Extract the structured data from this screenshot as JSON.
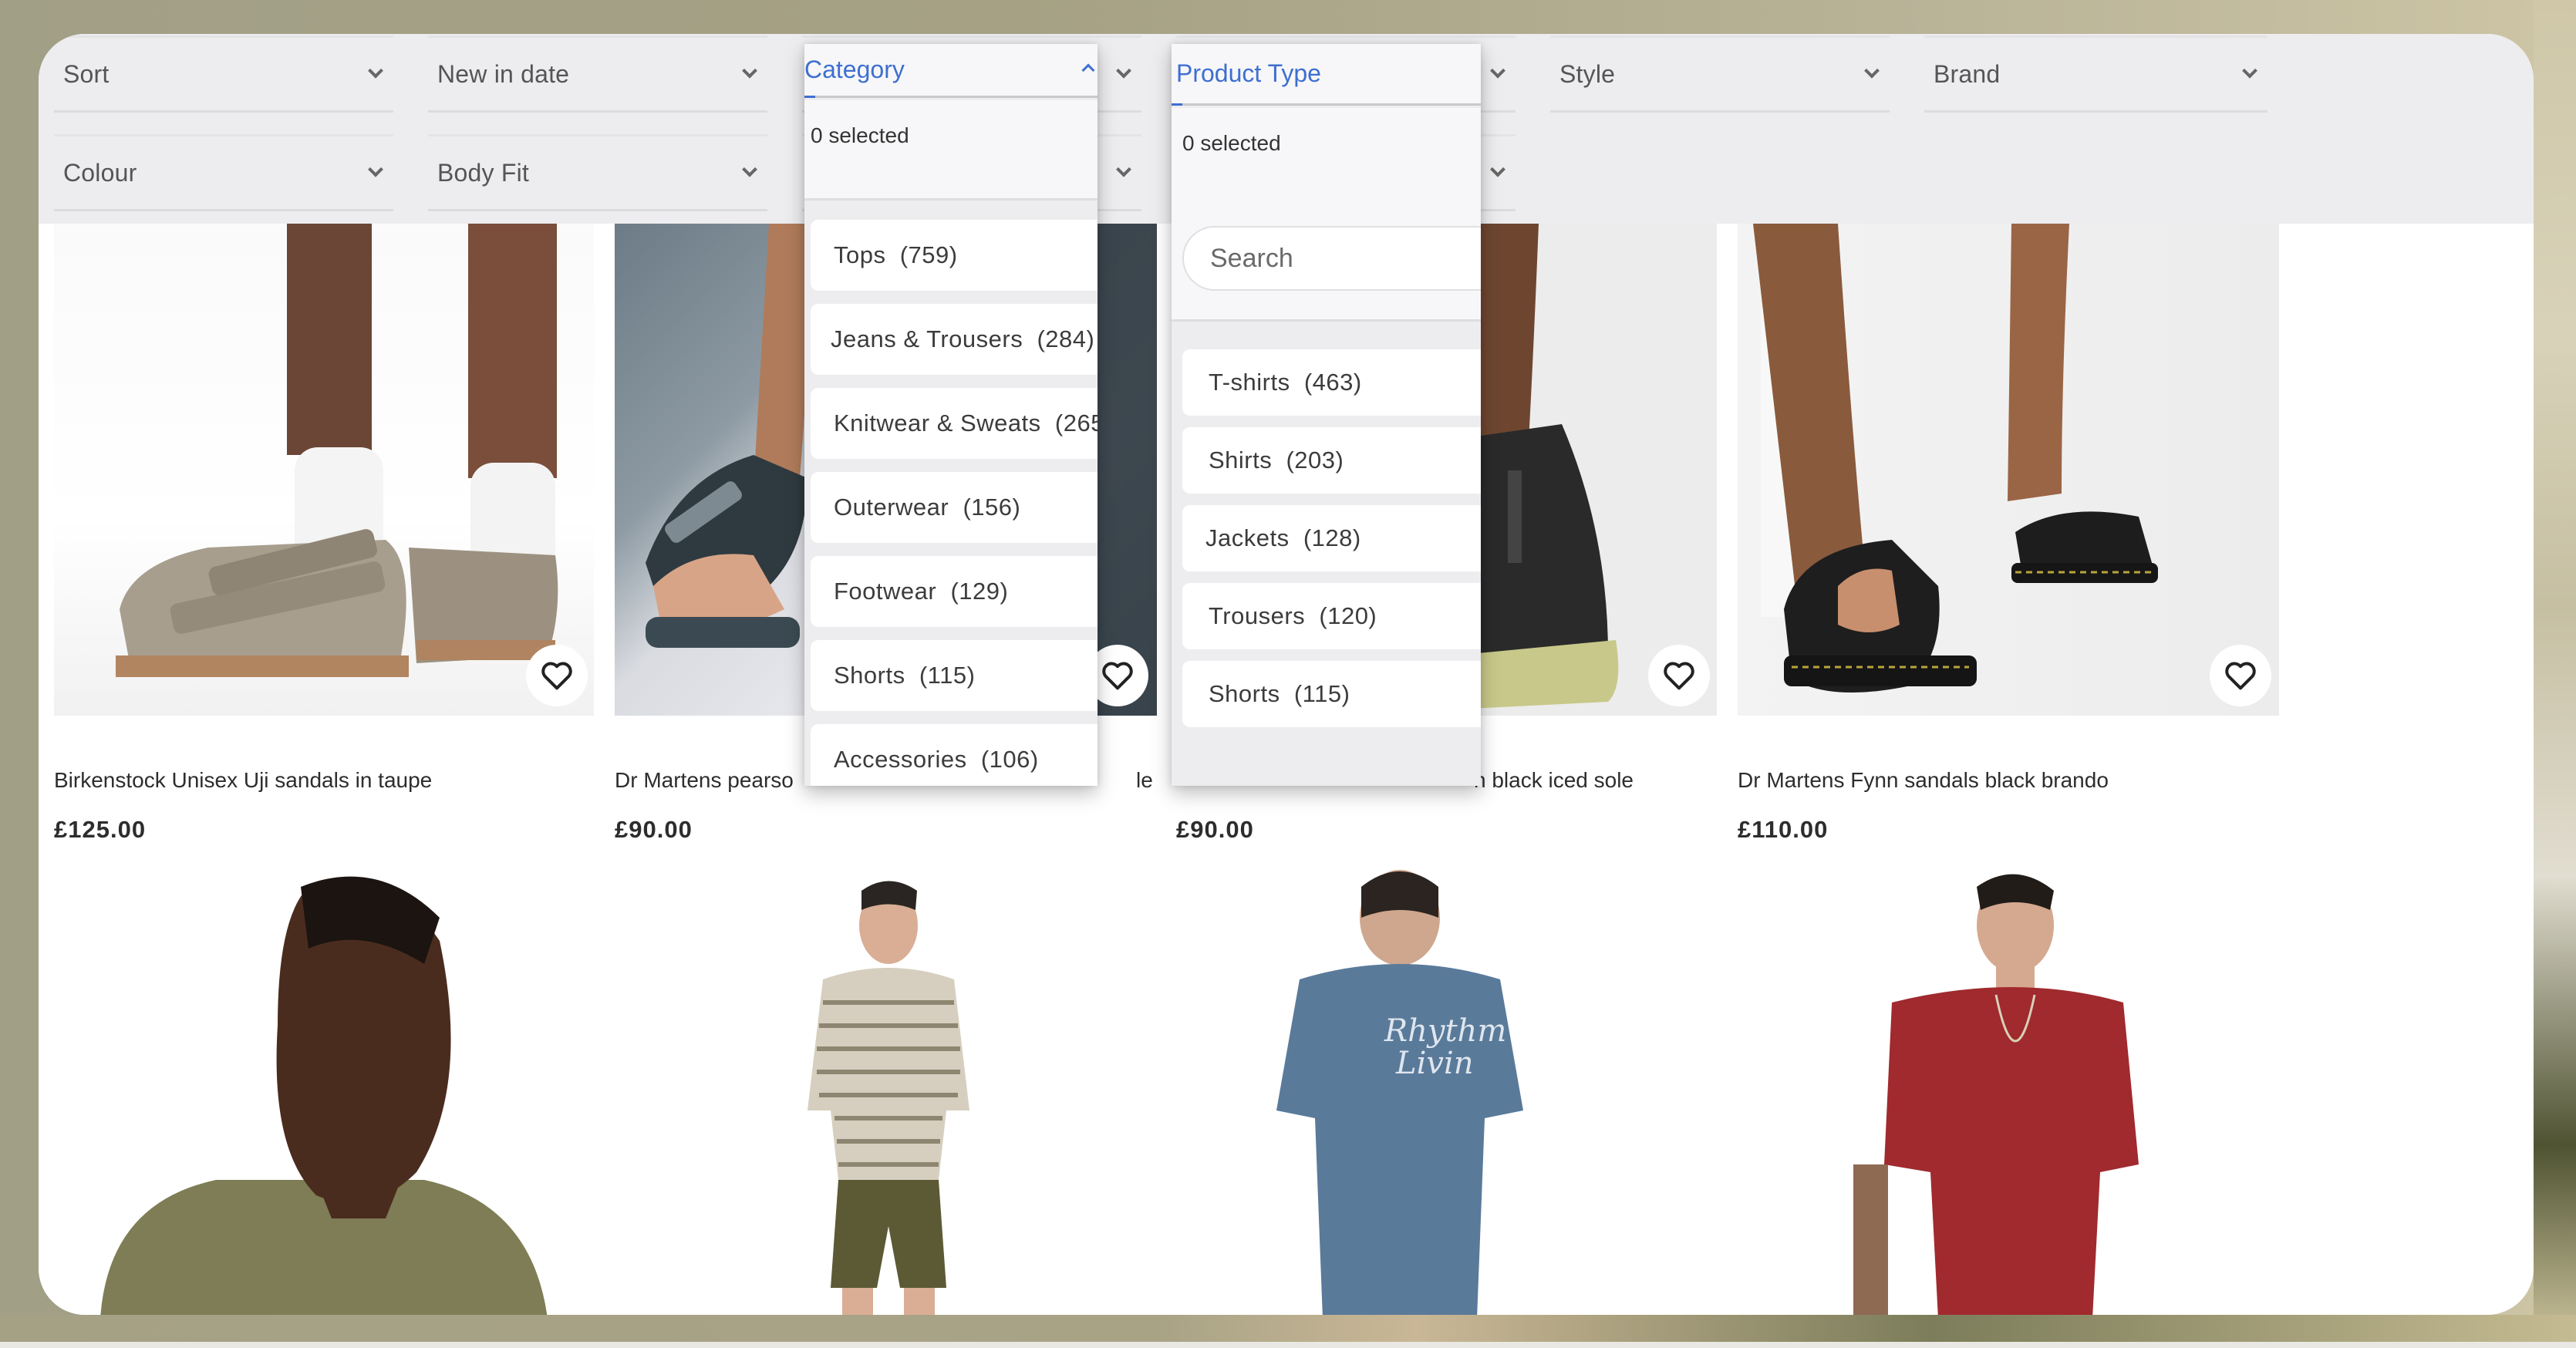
{
  "filters": {
    "row1": [
      {
        "label": "Sort"
      },
      {
        "label": "New in date"
      },
      {
        "label": "Category"
      },
      {
        "label": "Product Type"
      },
      {
        "label": "Style"
      },
      {
        "label": "Brand"
      }
    ],
    "row2": [
      {
        "label": "Colour"
      },
      {
        "label": "Body Fit"
      }
    ]
  },
  "category_dropdown": {
    "title": "Category",
    "selected_count": "0 selected",
    "options": [
      {
        "label": "Tops",
        "count": "(759)"
      },
      {
        "label": "Jeans & Trousers",
        "count": "(284)"
      },
      {
        "label": "Knitwear & Sweats",
        "count": "(265"
      },
      {
        "label": "Outerwear",
        "count": "(156)"
      },
      {
        "label": "Footwear",
        "count": "(129)"
      },
      {
        "label": "Shorts",
        "count": "(115)"
      },
      {
        "label": "Accessories",
        "count": "(106)"
      }
    ]
  },
  "product_type_dropdown": {
    "title": "Product Type",
    "selected_count": "0 selected",
    "search_placeholder": "Search",
    "options": [
      {
        "label": "T-shirts",
        "count": "(463)"
      },
      {
        "label": "Shirts",
        "count": "(203)"
      },
      {
        "label": "Jackets",
        "count": "(128)"
      },
      {
        "label": "Trousers",
        "count": "(120)"
      },
      {
        "label": "Shorts",
        "count": "(115)"
      }
    ]
  },
  "products_row1": [
    {
      "name": "Birkenstock Unisex Uji sandals in taupe",
      "price": "£125.00",
      "image": "taupe-suede-sandals-with-white-socks"
    },
    {
      "name": "Dr Martens pearso",
      "name_tail": "le",
      "price": "£90.00",
      "image": "black-strappy-sandals-on-grey"
    },
    {
      "name_tail": "n black iced sole",
      "price": "£90.00",
      "image": "black-sandal-iced-sole"
    },
    {
      "name": "Dr Martens Fynn sandals black brando",
      "price": "£110.00",
      "image": "black-strappy-platform-sandals"
    }
  ],
  "products_row2": [
    {
      "image": "model-olive-tshirt-closeup"
    },
    {
      "image": "model-striped-tshirt-khaki-shorts"
    },
    {
      "image": "model-blue-rhythm-livin-tshirt-back"
    },
    {
      "image": "model-red-tshirt"
    }
  ],
  "icons": {
    "heart": "heart-outline-icon",
    "chevron": "chevron-down-icon",
    "chevron_up": "chevron-up-icon"
  },
  "colors": {
    "accent": "#3e6fd0",
    "filterbar": "#ededef",
    "text": "#2d2d2d"
  }
}
